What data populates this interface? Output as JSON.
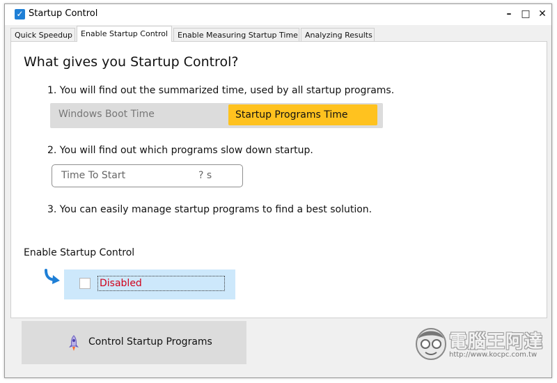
{
  "window": {
    "title": "Startup Control",
    "controls": {
      "minimize": "–",
      "maximize": "□",
      "close": "✕"
    }
  },
  "tabs": [
    {
      "label": "Quick Speedup",
      "active": false
    },
    {
      "label": "Enable Startup Control",
      "active": true
    },
    {
      "label": "Enable Measuring Startup Time",
      "active": false
    },
    {
      "label": "Analyzing Results",
      "active": false
    }
  ],
  "panel": {
    "heading": "What gives you Startup Control?",
    "step1": "1. You will find out the summarized time, used by all startup programs.",
    "segment": {
      "left": "Windows Boot Time",
      "right": "Startup Programs Time"
    },
    "step2": "2. You will find out which programs slow down startup.",
    "time_to_start": {
      "label": "Time To Start",
      "value": "? s"
    },
    "step3": "3. You can easily manage startup programs to find a best solution.",
    "enable_title": "Enable Startup Control",
    "enable_checkbox": {
      "checked": false,
      "label": "Disabled"
    }
  },
  "bottom_button": {
    "label": "Control Startup Programs",
    "icon": "rocket-icon"
  },
  "watermark": {
    "text": "電腦王阿達",
    "url": "http://www.kocpc.com.tw"
  },
  "colors": {
    "accent_yellow": "#ffc21f",
    "enable_box_blue": "#cde8fb",
    "disabled_red": "#d0021b",
    "arrow_blue": "#1e7fd6"
  }
}
